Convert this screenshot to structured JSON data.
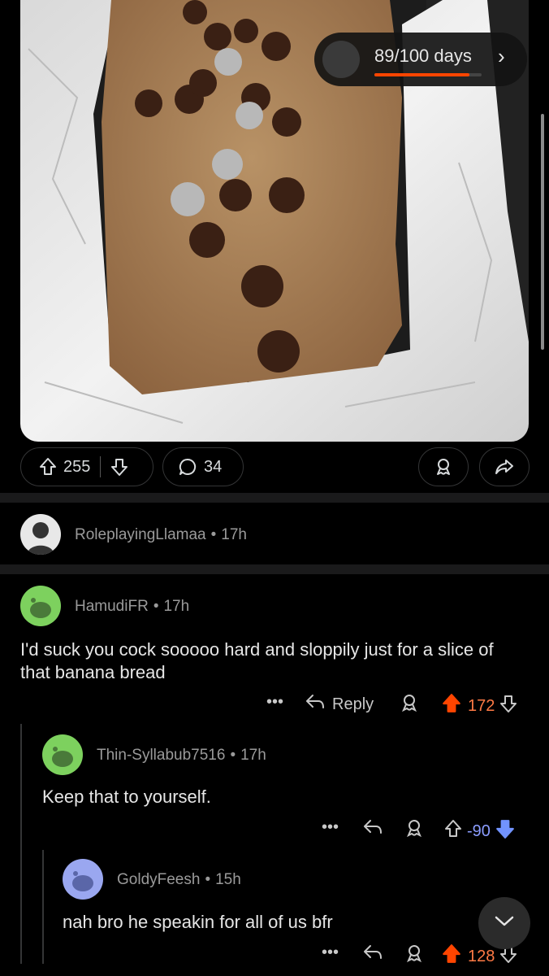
{
  "post": {
    "streak": {
      "label": "89/100 days",
      "progress": 0.89
    },
    "upvotes": "255",
    "comments": "34"
  },
  "comments": [
    {
      "user": "RoleplayingLlamaa",
      "time": "17h"
    },
    {
      "user": "HamudiFR",
      "time": "17h",
      "body": "I'd suck you cock sooooo hard and sloppily just for a slice of that banana bread",
      "more": "•••",
      "reply": "Reply",
      "votes": "172"
    },
    {
      "user": "Thin-Syllabub7516",
      "time": "17h",
      "body": "Keep that to yourself.",
      "more": "•••",
      "votes": "-90"
    },
    {
      "user": "GoldyFeesh",
      "time": "15h",
      "body": "nah bro he speakin for all of us bfr",
      "more": "•••",
      "votes": "128"
    }
  ],
  "colors": {
    "upvote": "#ff4500",
    "downvote": "#7193ff",
    "avatar_green": "#7dd15e",
    "avatar_blue": "#9aa7f0"
  },
  "icons": [
    "upvote-icon",
    "downvote-icon",
    "comment-icon",
    "award-icon",
    "share-icon",
    "reply-icon",
    "chevron-down-icon"
  ]
}
